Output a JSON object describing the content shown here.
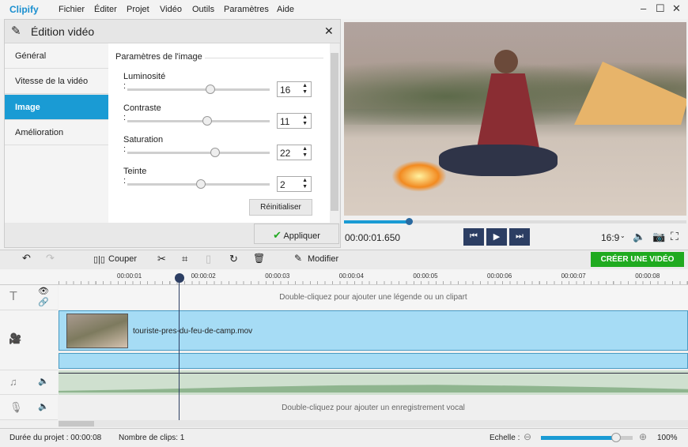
{
  "app": {
    "logo": "Clipify"
  },
  "menu": [
    "Fichier",
    "Éditer",
    "Projet",
    "Vidéo",
    "Outils",
    "Paramètres",
    "Aide"
  ],
  "editor": {
    "title": "Édition vidéo",
    "tabs": [
      {
        "label": "Général"
      },
      {
        "label": "Vitesse de la vidéo"
      },
      {
        "label": "Image",
        "selected": true
      },
      {
        "label": "Amélioration"
      }
    ],
    "section": "Paramètres de l'image",
    "params": [
      {
        "label": "Luminosité :",
        "value": "16"
      },
      {
        "label": "Contraste :",
        "value": "11"
      },
      {
        "label": "Saturation :",
        "value": "22"
      },
      {
        "label": "Teinte :",
        "value": "2"
      }
    ],
    "reset": "Réinitialiser",
    "apply": "Appliquer"
  },
  "player": {
    "time": "00:00:01.650",
    "aspect": "16:9",
    "progress": 0.19
  },
  "toolbar": {
    "cut": "Couper",
    "modify": "Modifier",
    "create": "CRÉER UNE VIDÉO"
  },
  "timeline": {
    "ticks": [
      "00:00:01",
      "00:00:02",
      "00:00:03",
      "00:00:04",
      "00:00:05",
      "00:00:06",
      "00:00:07",
      "00:00:08"
    ],
    "caption_hint": "Double-cliquez pour ajouter une légende ou un clipart",
    "clip_name": "touriste-pres-du-feu-de-camp.mov",
    "voice_hint": "Double-cliquez pour ajouter un enregistrement vocal"
  },
  "status": {
    "duration": "Durée du projet :  00:00:08",
    "clips": "Nombre de clips: 1",
    "scale_label": "Echelle :",
    "zoom": "100%",
    "scale_value": 0.82
  },
  "colors": {
    "accent": "#1a9bd4",
    "create": "#1faa1f"
  }
}
